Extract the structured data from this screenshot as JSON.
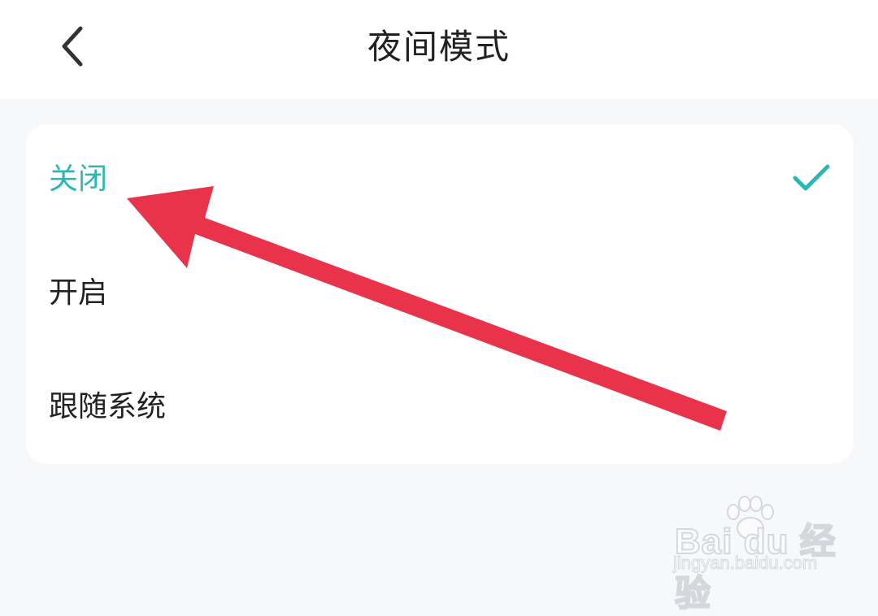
{
  "header": {
    "title": "夜间模式",
    "back_icon": "chevron-left-icon"
  },
  "options": [
    {
      "label": "关闭",
      "selected": true
    },
    {
      "label": "开启",
      "selected": false
    },
    {
      "label": "跟随系统",
      "selected": false
    }
  ],
  "colors": {
    "accent": "#2bb8b5",
    "annotation_arrow": "#e8334a",
    "text": "#222222",
    "background": "#f7f8fa"
  },
  "watermark": {
    "logo_text": "Bai du 经验",
    "site": "jingyan.baidu.com"
  }
}
